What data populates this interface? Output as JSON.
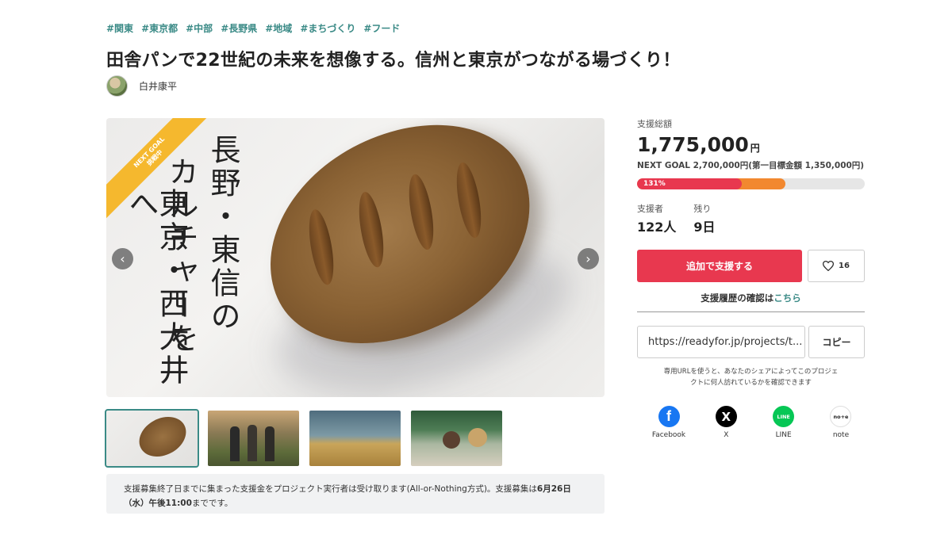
{
  "tags": [
    "#関東",
    "#東京都",
    "#中部",
    "#長野県",
    "#地域",
    "#まちづくり",
    "#フード"
  ],
  "title": "田舎パンで22世紀の未来を想像する。信州と東京がつながる場づくり！",
  "author": {
    "name": "白井康平"
  },
  "hero": {
    "ribbon_line1": "NEXT GOAL",
    "ribbon_line2": "挑戦中",
    "vertical_lines": [
      "長野・東信の",
      "カルチャーを",
      "東京・西大井へ"
    ],
    "prev_icon": "chevron-left-icon",
    "next_icon": "chevron-right-icon"
  },
  "notice": {
    "text_plain": "支援募集終了日までに集まった支援金をプロジェクト実行者は受け取ります(All-or-Nothing方式)。支援募集は",
    "text_bold": "6月26日（水）午後11:00",
    "text_end": "までです。"
  },
  "funding": {
    "total_label": "支援総額",
    "total_amount": "1,775,000",
    "currency": "円",
    "next_goal": "NEXT GOAL 2,700,000円(第一目標金額 1,350,000円)",
    "percent_label": "131%",
    "progress_red_fraction": 0.46,
    "progress_orange_fraction": 0.65,
    "supporters_label": "支援者",
    "supporters_value": "122人",
    "remaining_label": "残り",
    "remaining_value": "9日"
  },
  "actions": {
    "support_button": "追加で支援する",
    "favorite_count": "16",
    "favorite_icon": "heart-icon",
    "history_text": "支援履歴の確認は",
    "history_link": "こちら"
  },
  "share_url": {
    "url": "https://readyfor.jp/projects/t...",
    "copy_label": "コピー",
    "note_line1": "専用URLを使うと、あなたのシェアによってこのプロジェ",
    "note_line2": "クトに何人訪れているかを確認できます"
  },
  "share": [
    {
      "label": "Facebook",
      "icon": "facebook-icon",
      "color": "#1877f2",
      "glyph": "f"
    },
    {
      "label": "X",
      "icon": "x-icon",
      "color": "#000000",
      "glyph": "X"
    },
    {
      "label": "LINE",
      "icon": "line-icon",
      "color": "#06c755",
      "glyph": "LINE"
    },
    {
      "label": "note",
      "icon": "note-icon",
      "color": "#ffffff",
      "glyph": "no+e"
    }
  ]
}
